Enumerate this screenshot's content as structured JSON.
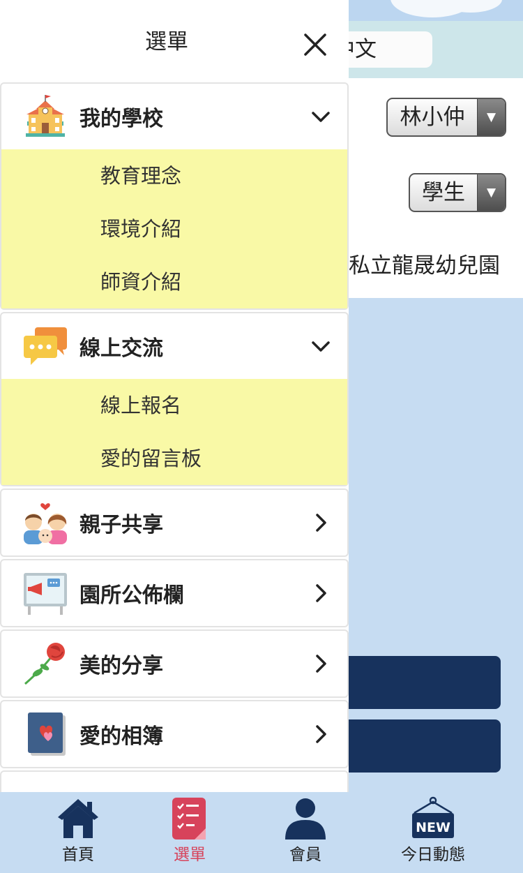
{
  "background": {
    "language_label": "中文",
    "user_select": "林小仲",
    "role_select": "學生",
    "school_name": "私立龍晟幼兒園"
  },
  "drawer": {
    "title": "選單",
    "groups": [
      {
        "label": "我的學校",
        "icon": "school-icon",
        "expanded": true,
        "items": [
          "教育理念",
          "環境介紹",
          "師資介紹"
        ]
      },
      {
        "label": "線上交流",
        "icon": "chat-bubbles-icon",
        "expanded": true,
        "items": [
          "線上報名",
          "愛的留言板"
        ]
      },
      {
        "label": "親子共享",
        "icon": "family-icon",
        "expanded": false
      },
      {
        "label": "園所公佈欄",
        "icon": "bulletin-board-icon",
        "expanded": false
      },
      {
        "label": "美的分享",
        "icon": "rose-icon",
        "expanded": false
      },
      {
        "label": "愛的相簿",
        "icon": "photo-album-icon",
        "expanded": false
      }
    ]
  },
  "bottom_nav": {
    "items": [
      {
        "label": "首頁",
        "icon": "home-icon",
        "active": false
      },
      {
        "label": "選單",
        "icon": "menu-checklist-icon",
        "active": true
      },
      {
        "label": "會員",
        "icon": "member-icon",
        "active": false
      },
      {
        "label": "今日動態",
        "icon": "new-sign-icon",
        "active": false
      }
    ],
    "active_color": "#d7435b"
  },
  "colors": {
    "submenu_bg": "#f9f9a6",
    "navy": "#17325d",
    "page_bg": "#c6dcf2"
  }
}
